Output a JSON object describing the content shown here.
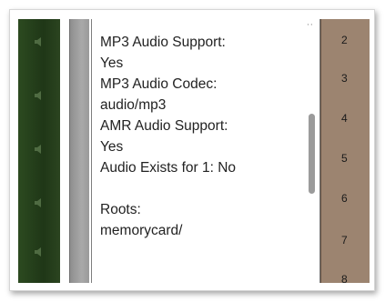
{
  "info_lines": [
    "MP3 Audio Support:",
    "Yes",
    "MP3 Audio Codec:",
    "audio/mp3",
    "AMR Audio Support:",
    "Yes",
    "Audio Exists for 1: No",
    "",
    "Roots:",
    "memorycard/"
  ],
  "line_numbers": [
    "2",
    "3",
    "4",
    "5",
    "6",
    "7",
    "8"
  ],
  "icons": {
    "left_strip": "speaker-icon"
  },
  "colors": {
    "left_strip": "#233d1a",
    "right_strip": "#9c8470",
    "text": "#222222"
  }
}
